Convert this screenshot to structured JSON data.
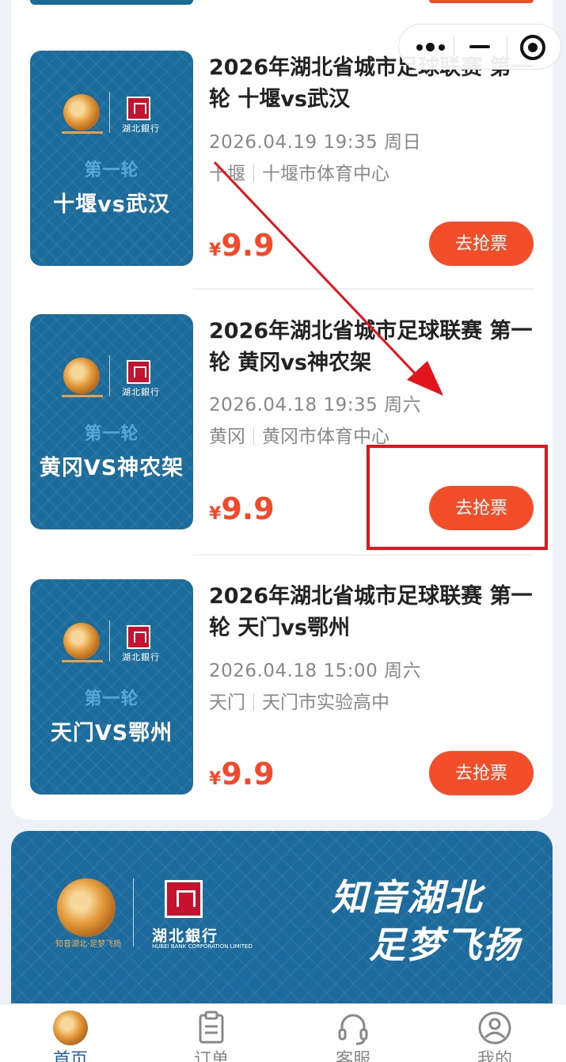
{
  "matches": [
    {
      "title": "2026年湖北省城市足球联赛 第一轮 十堰vs武汉",
      "datetime": "2026.04.19 19:35 周日",
      "city": "十堰",
      "venue": "十堰市体育中心",
      "currency": "¥",
      "price": "9.9",
      "button": "去抢票",
      "thumb_round": "第一轮",
      "thumb_teams": "十堰vs武汉",
      "thumb_bank": "湖北銀行"
    },
    {
      "title": "2026年湖北省城市足球联赛 第一轮 黄冈vs神农架",
      "datetime": "2026.04.18 19:35 周六",
      "city": "黄冈",
      "venue": "黄冈市体育中心",
      "currency": "¥",
      "price": "9.9",
      "button": "去抢票",
      "thumb_round": "第一轮",
      "thumb_teams": "黄冈VS神农架",
      "thumb_bank": "湖北銀行"
    },
    {
      "title": "2026年湖北省城市足球联赛 第一轮 天门vs鄂州",
      "datetime": "2026.04.18 15:00 周六",
      "city": "天门",
      "venue": "天门市实验高中",
      "currency": "¥",
      "price": "9.9",
      "button": "去抢票",
      "thumb_round": "第一轮",
      "thumb_teams": "天门VS鄂州",
      "thumb_bank": "湖北銀行"
    }
  ],
  "banner": {
    "bank_name": "湖北銀行",
    "bank_name_en": "HUBEI BANK CORPORATION LIMITED",
    "ball_caption": "知音湖北·足梦飞扬",
    "slogan_line1": "知音湖北",
    "slogan_line2": "足梦飞扬"
  },
  "tabbar": {
    "items": [
      {
        "label": "首页",
        "icon": "home-football-icon",
        "active": true
      },
      {
        "label": "订单",
        "icon": "clipboard-icon",
        "active": false
      },
      {
        "label": "客服",
        "icon": "headset-icon",
        "active": false
      },
      {
        "label": "我的",
        "icon": "user-icon",
        "active": false
      }
    ]
  },
  "capsule": {
    "icons": [
      "more-dots-icon",
      "minimize-icon",
      "close-target-icon"
    ]
  },
  "colors": {
    "accent": "#f24e2a",
    "thumb_bg": "#1b6b9b",
    "active_tab": "#1f5fa0",
    "annotation": "#e2141c"
  }
}
